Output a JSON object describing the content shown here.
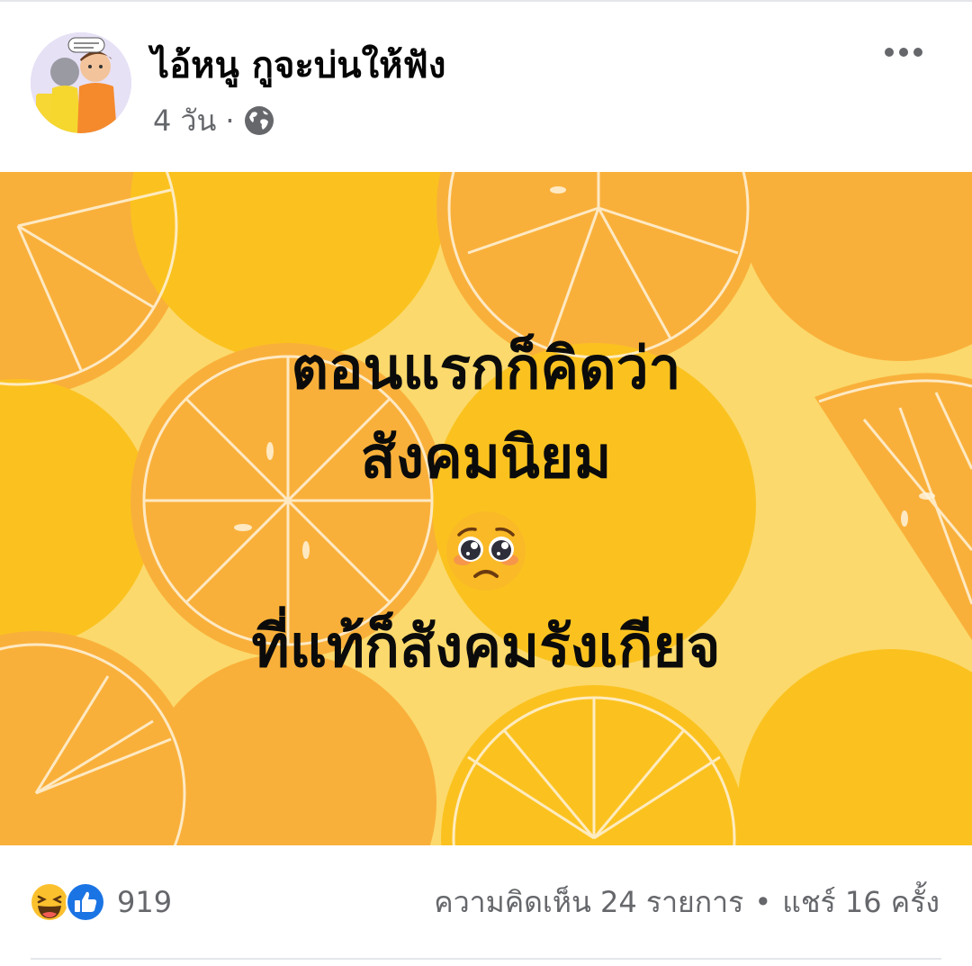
{
  "post": {
    "author": "ไอ้หนู กูจะบ่นให้ฟัง",
    "time": "4 วัน",
    "separator": "·",
    "privacy_icon": "globe-icon",
    "more_icon": "more-horizontal-icon",
    "avatar_icon": "page-avatar-illustration"
  },
  "image": {
    "lines": [
      "ตอนแรกก็คิดว่า",
      "สังคมนิยม",
      "ที่แท้ก็สังคมรังเกียจ"
    ],
    "emoji": "pleading-face-emoji",
    "colors": {
      "background": "#fbd96c",
      "lemon": "#fbc21f",
      "orange": "#f9b03a",
      "slice_lines": "#fff3dc"
    }
  },
  "footer": {
    "reaction_icons": [
      "haha-reaction-icon",
      "like-reaction-icon"
    ],
    "reaction_count": "919",
    "comments": "ความคิดเห็น 24 รายการ",
    "dot": "•",
    "shares": "แชร์ 16 ครั้ง"
  }
}
